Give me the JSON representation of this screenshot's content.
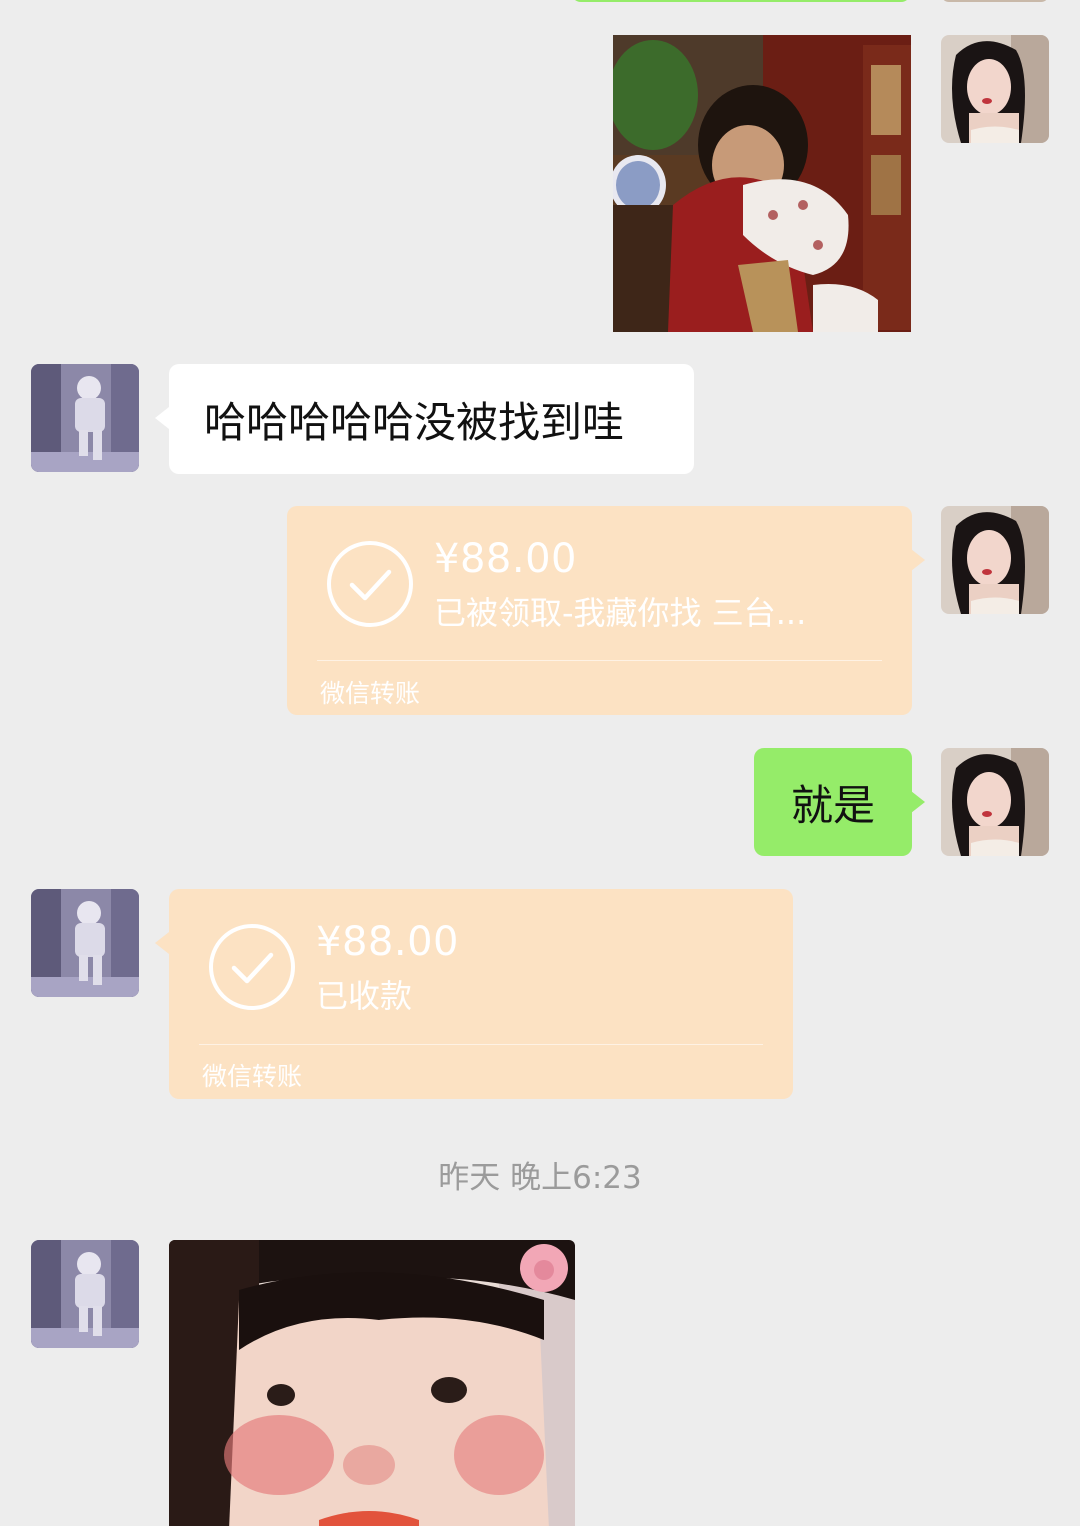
{
  "messages": {
    "m2_text": "哈哈哈哈哈没被找到哇",
    "m3_transfer": {
      "amount": "¥88.00",
      "status": "已被领取-我藏你找 三台...",
      "footer": "微信转账"
    },
    "m4_text": "就是",
    "m5_transfer": {
      "amount": "¥88.00",
      "status": "已收款",
      "footer": "微信转账"
    },
    "timestamp": "昨天 晚上6:23"
  },
  "colors": {
    "background": "#EDEDED",
    "green_bubble": "#95EC69",
    "white_bubble": "#FFFFFF",
    "transfer_card": "#FCE2C3",
    "timestamp_text": "#9B9B9B"
  },
  "icons": {
    "transfer_check": "check-circle-icon"
  }
}
